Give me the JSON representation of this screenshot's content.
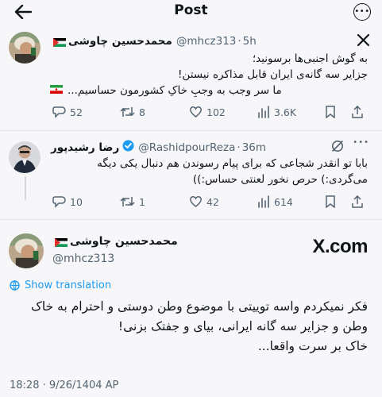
{
  "header": {
    "title": "Post"
  },
  "tweet1": {
    "author_name": "محمدحسین چاوشی",
    "handle": "@mhcz313",
    "time": "5h",
    "lines": [
      "به گوش اجنبی‌ها برسونید؛",
      "جزایر سه گانه‌ی ایران قابل مذاکره نیستن!",
      "ما سر وجب به وجبِ خاکِ کشورمون حساسیم..."
    ],
    "replies": "52",
    "retweets": "8",
    "likes": "102",
    "views": "3.6K"
  },
  "tweet2": {
    "author_name": "رضا رشیدپور",
    "handle": "@RashidpourReza",
    "time": "36m",
    "lines": [
      "بابا تو انقدر شجاعی که برای پیام رسوندن هم دنبال یکی دیگه",
      "می‌گردی:) حرص نخور لعنتی حساس:))"
    ],
    "replies": "10",
    "retweets": "1",
    "likes": "42",
    "views": "614"
  },
  "main_tweet": {
    "author_name": "محمدحسین چاوشی",
    "handle": "@mhcz313",
    "site": "X.com",
    "show_translation": "Show translation",
    "lines": [
      "فکر نمیکردم واسه توییتی با موضوع وطن دوستی و احترام به خاک",
      "وطن و جزایر سه گانه ایرانی، بیای و جفتک بزنی!",
      "خاک بر سرت واقعا..."
    ],
    "timestamp": "18:28 · 9/26/1404 AP"
  },
  "colors": {
    "link": "#1d9bf0",
    "muted": "#536471",
    "verified": "#1d9bf0"
  }
}
